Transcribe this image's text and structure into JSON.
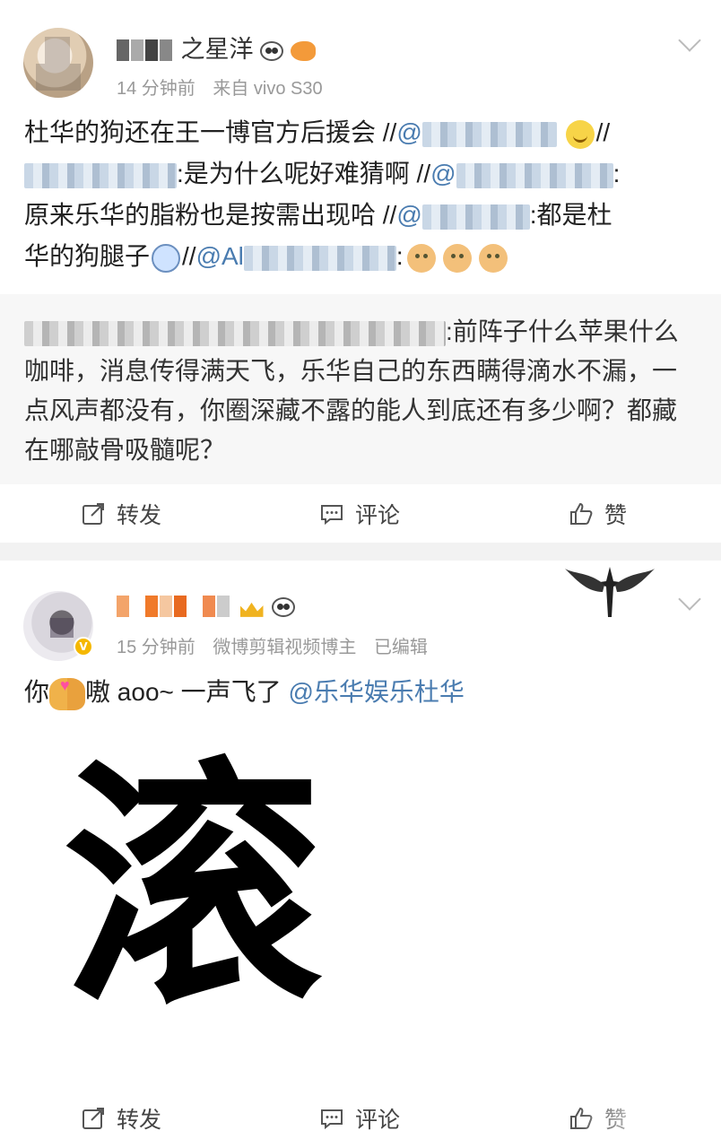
{
  "post1": {
    "username_suffix": "之星洋",
    "time": "14 分钟前",
    "source": "来自 vivo S30",
    "text_lead": "杜华的狗还在王一博官方后援会 //",
    "at1": "@",
    "seg2": ":是为什么呢好难猜啊 //",
    "at2": "@",
    "seg3": ":",
    "line3": "原来乐华的脂粉也是按需出现哈 //",
    "at3": "@",
    "seg4": ":都是杜",
    "line4a": "华的狗腿子",
    "line4b": "//",
    "at4": "@Al",
    "seg5": ":",
    "repost_text": ":前阵子什么苹果什么咖啡，消息传得满天飞，乐华自己的东西瞒得滴水不漏，一点风声都没有，你圈深藏不露的能人到底还有多少啊？都藏在哪敲骨吸髓呢？",
    "actions": {
      "repost": "转发",
      "comment": "评论",
      "like": "赞"
    }
  },
  "post2": {
    "username_suffix": "",
    "time": "15 分钟前",
    "source": "微博剪辑视频博主",
    "edited": "已编辑",
    "verified_badge": "V",
    "text_a": "你",
    "text_b": "嗷 aoo~ 一声飞了 ",
    "mention": "@乐华娱乐杜华",
    "image_char": "滚",
    "actions": {
      "repost": "转发",
      "comment": "评论",
      "like": "赞"
    }
  },
  "colors": {
    "mention": "#4a7cb0",
    "meta": "#999999",
    "divider": "#f2f2f2",
    "repost_bg": "#f7f7f7"
  },
  "icons": [
    "chevron-down-icon",
    "repost-icon",
    "comment-icon",
    "like-icon",
    "verified-icon",
    "panda-emoji",
    "fish-emoji",
    "crown-emoji",
    "dog-emoji",
    "smile-emoji",
    "kiss-emoji",
    "cross-wings-icon"
  ]
}
